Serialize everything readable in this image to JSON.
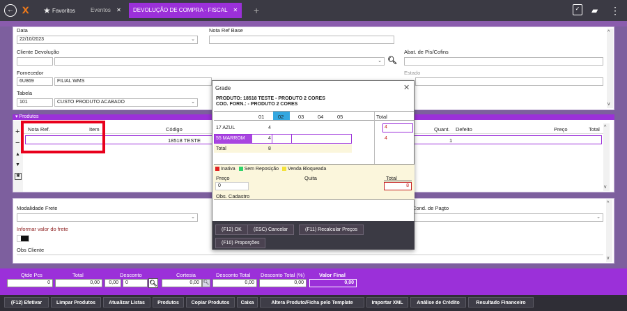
{
  "tabs": {
    "favoritos": "Favoritos",
    "eventos": "Eventos",
    "devolucao": "DEVOLUÇÃO DE COMPRA - FISCAL",
    "close": "✕",
    "add": "+"
  },
  "form": {
    "data_label": "Data",
    "data_value": "22/10/2023",
    "nota_ref_base_label": "Nota Ref Base",
    "cliente_devolucao_label": "Cliente Devolução",
    "abat_label": "Abat. de Pis/Cofins",
    "fornecedor_label": "Fornecedor",
    "fornecedor_code": "6U869",
    "fornecedor_name": "FILIAL WMS",
    "estado_label": "Estado",
    "tabela_label": "Tabela",
    "tabela_code": "101",
    "tabela_name": "CUSTO PRODUTO ACABADO"
  },
  "produtos": {
    "header": "Produtos",
    "columns": {
      "nota_ref": "Nota Ref.",
      "item": "Item",
      "codigo": "Código",
      "quant": "Quant.",
      "defeito": "Defeito",
      "preco": "Preço",
      "total": "Total"
    },
    "row": {
      "codigo": "18518 TESTE",
      "quant": "1"
    }
  },
  "lower": {
    "modalidade_label": "Modalidade Frete",
    "informar_frete": "Informar valor do frete",
    "obs_cliente": "Obs Cliente",
    "cond_pagto": "Cond. de Pagto"
  },
  "grade": {
    "title": "Grade",
    "produto_line": "PRODUTO: 18518 TESTE - PRODUTO 2 CORES",
    "cod_forn_line": "COD. FORN.: - PRODUTO 2 CORES",
    "sizes": [
      "01",
      "02",
      "03",
      "04",
      "05"
    ],
    "total_label": "Total",
    "rows": [
      {
        "name": "17 AZUL",
        "v01": "4",
        "total": "4"
      },
      {
        "name": "55 MARROM",
        "v01": "4",
        "total": "4"
      }
    ],
    "total_row": {
      "name": "Total",
      "v01": "8"
    },
    "legend": {
      "inativa": "Inativa",
      "sem_reposicao": "Sem Reposição",
      "venda_bloqueada": "Venda Bloqueada"
    },
    "preco_label": "Preço",
    "quita_label": "Quita",
    "total2_label": "Total",
    "preco_value": "0",
    "total_value": "8",
    "obs_cadastro": "Obs. Cadastro",
    "buttons": {
      "ok": "(F12) OK",
      "cancelar": "(ESC) Cancelar",
      "recalcular": "(F11) Recalcular Preços",
      "proporcoes": "(F10) Proporções"
    }
  },
  "totals": {
    "qtde_pcs_label": "Qtde Pcs",
    "qtde_pcs": "0",
    "total_label": "Total",
    "total": "0,00",
    "desconto_label": "Desconto",
    "desconto_a": "0,00",
    "desconto_b": "0",
    "cortesia_label": "Cortesia",
    "cortesia": "0,00",
    "desconto_total_label": "Desconto Total",
    "desconto_total": "0,00",
    "desconto_total_pct_label": "Desconto Total (%)",
    "desconto_total_pct": "0,00",
    "valor_final_label": "Valor Final",
    "valor_final": "0,00"
  },
  "footer": {
    "efetivar": "(F12) Efetivar",
    "limpar": "Limpar Produtos",
    "atualizar": "Atualizar Listas",
    "produtos": "Produtos",
    "copiar": "Copiar Produtos",
    "caixa": "Caixa",
    "altera": "Altera Produto/Ficha pelo Template",
    "importar": "Importar XML",
    "analise": "Análise de Crédito",
    "resultado": "Resultado Financeiro"
  },
  "colors": {
    "accent": "#9b30d9",
    "highlight": "#e8001c",
    "dark": "#3b3a44"
  }
}
